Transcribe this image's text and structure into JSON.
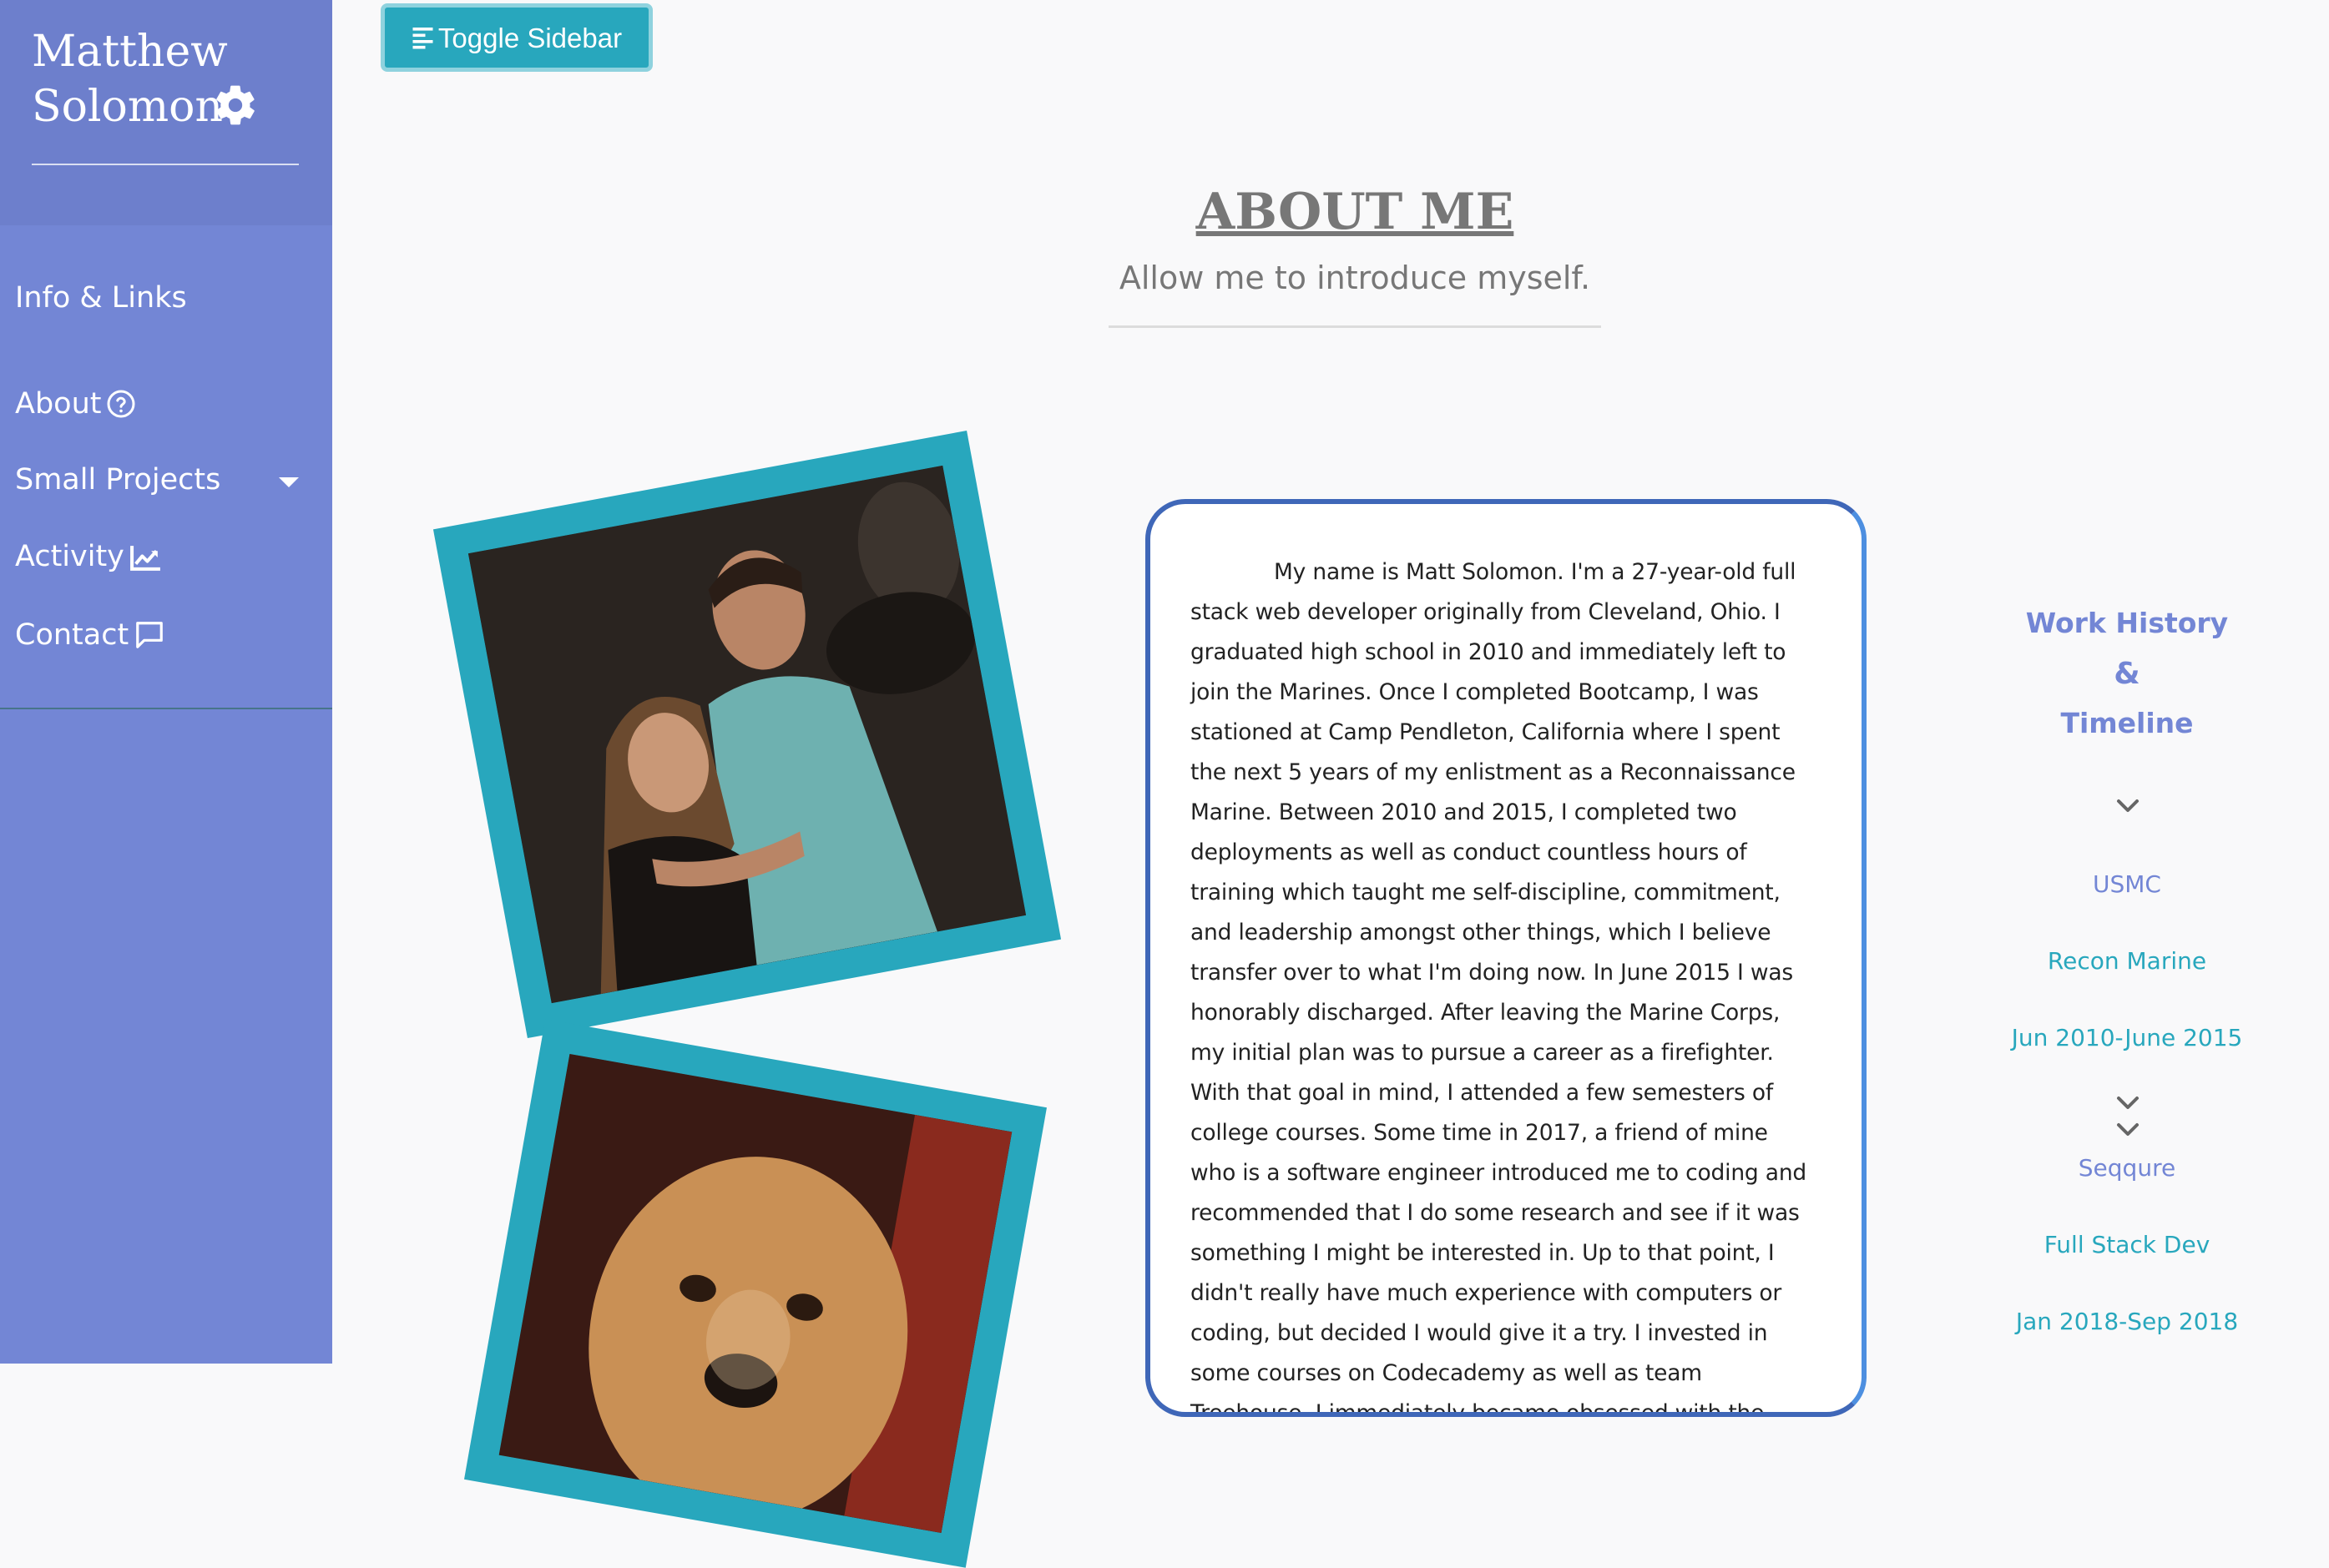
{
  "colors": {
    "sidebar_bg": "#7386d5",
    "sidebar_header_bg": "#6d7fcc",
    "accent_teal": "#28a7bd",
    "card_border": "#3f67b8"
  },
  "sidebar": {
    "brand_first": "Matthew",
    "brand_last": "Solomon",
    "brand_icon": "gear-icon",
    "items": [
      {
        "label": "Info & Links",
        "icon": null
      },
      {
        "label": "About",
        "icon": "question-circle-icon"
      },
      {
        "label": "Small Projects",
        "icon": "caret-down-icon"
      },
      {
        "label": "Activity",
        "icon": "chart-line-icon"
      },
      {
        "label": "Contact",
        "icon": "comment-icon"
      }
    ]
  },
  "toolbar": {
    "toggle_label": "Toggle Sidebar",
    "toggle_icon": "align-left-icon"
  },
  "header": {
    "title": "ABOUT ME",
    "subtitle": "Allow me to introduce myself."
  },
  "bio": {
    "text": "My name is Matt Solomon. I'm a 27-year-old full stack web developer originally from Cleveland, Ohio. I graduated high school in 2010 and immediately left to join the Marines. Once I completed Bootcamp, I was stationed at Camp Pendleton, California where I spent the next 5 years of my enlistment as a Reconnaissance Marine. Between 2010 and 2015, I completed two deployments as well as conduct countless hours of training which taught me self-discipline, commitment, and leadership amongst other things, which I believe transfer over to what I'm doing now. In June 2015 I was honorably discharged. After leaving the Marine Corps, my initial plan was to pursue a career as a firefighter. With that goal in mind, I attended a few semesters of college courses. Some time in 2017, a friend of mine who is a software engineer introduced me to coding and recommended that I do some research and see if it was something I might be interested in. Up to that point, I didn't really have much experience with computers or coding, but decided I would give it a try. I invested in some courses on Codecademy as well as team Treehouse. I immediately became obsessed with the problem solving"
  },
  "timeline": {
    "heading_line1": "Work History",
    "heading_amp": "&",
    "heading_line2": "Timeline",
    "entries": [
      {
        "org": "USMC",
        "role": "Recon Marine",
        "dates": "Jun 2010-June 2015"
      },
      {
        "org": "Seqqure",
        "role": "Full Stack Dev",
        "dates": "Jan 2018-Sep 2018"
      }
    ]
  }
}
